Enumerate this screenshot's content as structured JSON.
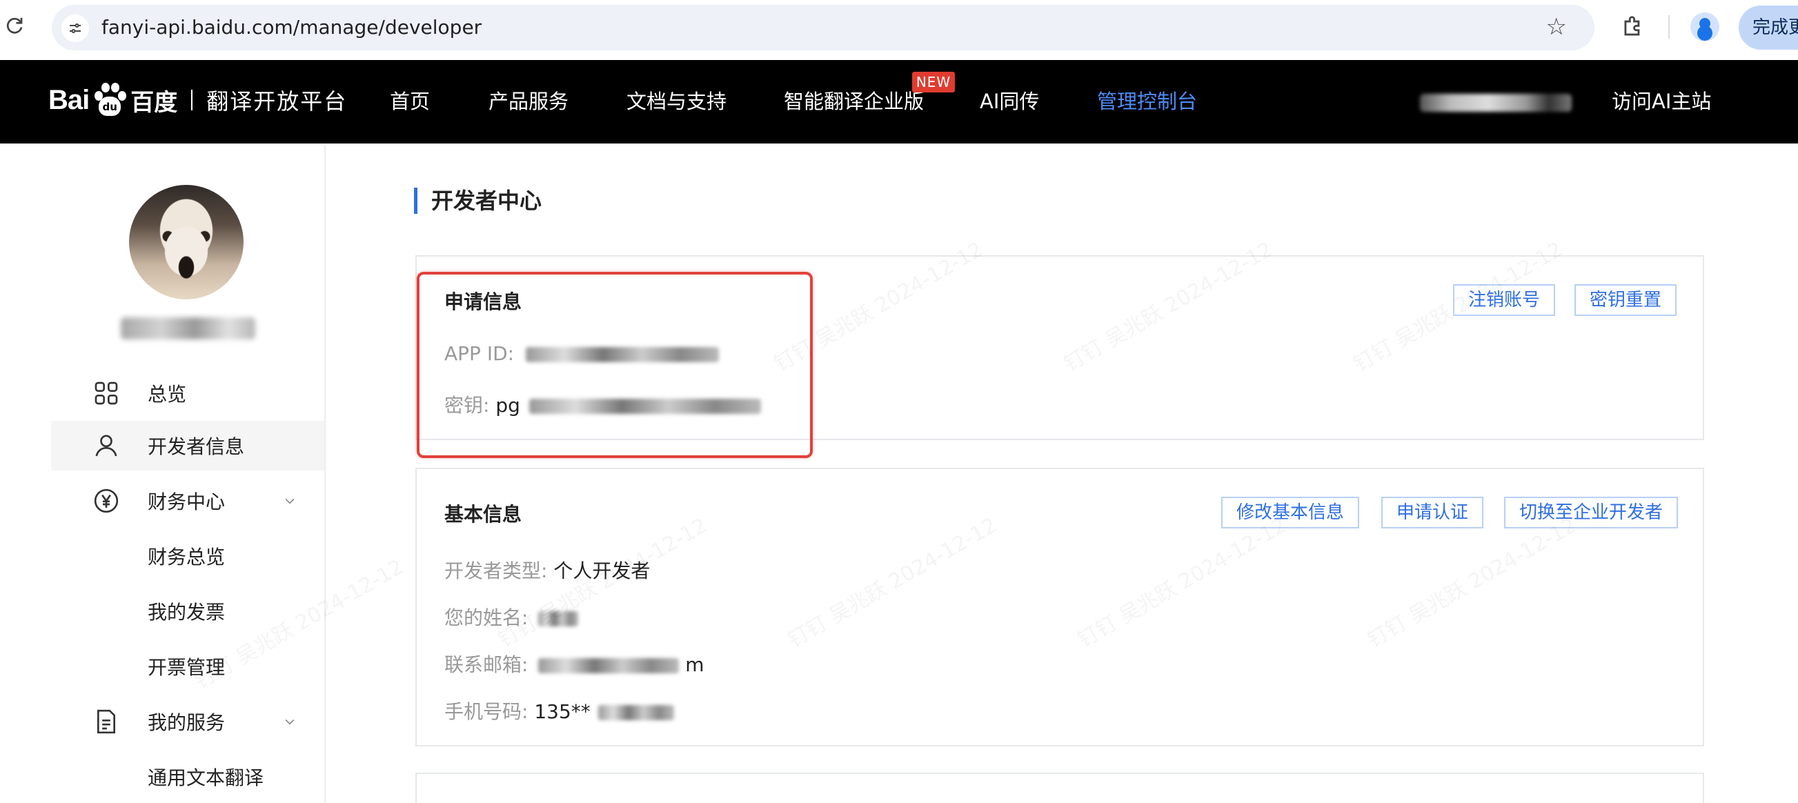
{
  "browser": {
    "url": "fanyi-api.baidu.com/manage/developer",
    "finish_button": "完成更"
  },
  "header": {
    "logo_bai": "Bai",
    "logo_du": "du",
    "logo_cn": "百度",
    "logo_sub": "翻译开放平台",
    "nav": [
      {
        "label": "首页"
      },
      {
        "label": "产品服务"
      },
      {
        "label": "文档与支持"
      },
      {
        "label": "智能翻译企业版"
      },
      {
        "label": "AI同传"
      },
      {
        "label": "管理控制台"
      }
    ],
    "new_badge": "NEW",
    "visit_ai": "访问AI主站",
    "active_color": "#4e8cf7"
  },
  "sidebar": {
    "items": [
      {
        "label": "总览",
        "icon": "grid-icon"
      },
      {
        "label": "开发者信息",
        "icon": "user-icon"
      },
      {
        "label": "财务中心",
        "icon": "yen-icon"
      },
      {
        "label": "财务总览"
      },
      {
        "label": "我的发票"
      },
      {
        "label": "开票管理"
      },
      {
        "label": "我的服务",
        "icon": "document-icon"
      },
      {
        "label": "通用文本翻译"
      }
    ]
  },
  "main": {
    "page_title": "开发者中心",
    "application": {
      "title": "申请信息",
      "app_id_label": "APP ID:",
      "secret_label": "密钥:",
      "secret_prefix": "pg",
      "buttons": {
        "cancel_account": "注销账号",
        "reset_key": "密钥重置"
      }
    },
    "basic": {
      "title": "基本信息",
      "dev_type_label": "开发者类型:",
      "dev_type_value": "个人开发者",
      "name_label": "您的姓名:",
      "email_label": "联系邮箱:",
      "email_suffix": "m",
      "phone_label": "手机号码:",
      "phone_value": "135**",
      "buttons": {
        "edit": "修改基本信息",
        "certify": "申请认证",
        "switch_enterprise": "切换至企业开发者"
      }
    }
  },
  "watermark": "钉钉 吴兆跃 2024-12-12"
}
